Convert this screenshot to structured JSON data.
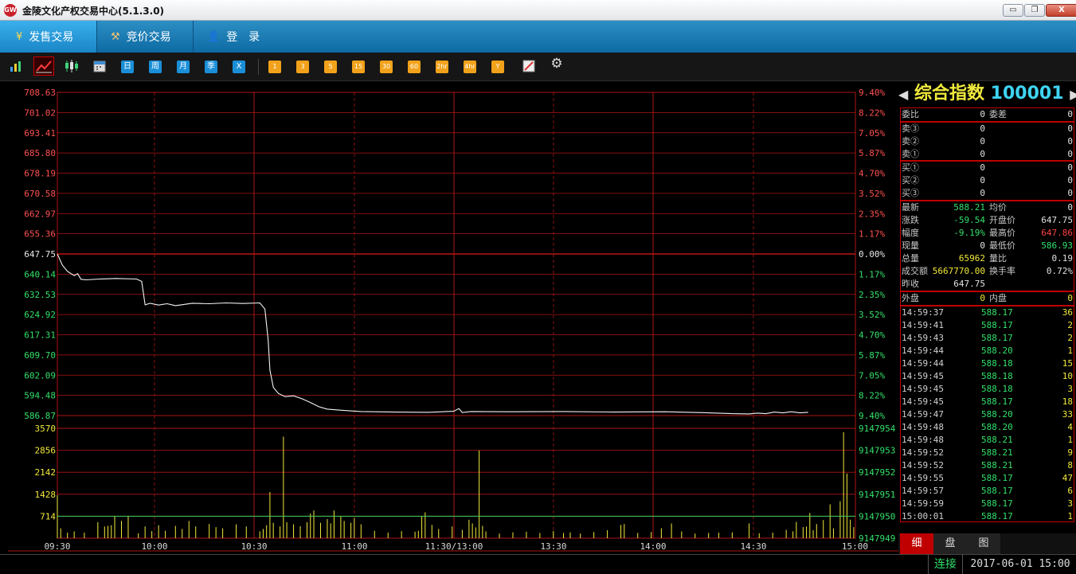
{
  "window": {
    "title": "金陵文化产权交易中心(5.1.3.0)",
    "logo": "GW",
    "min": "▭",
    "max": "❐",
    "close": "X"
  },
  "nav": {
    "tabs": [
      {
        "icon": "¥",
        "label": "发售交易"
      },
      {
        "icon": "⚒",
        "label": "竞价交易"
      },
      {
        "icon": "👤",
        "label": "登　录"
      }
    ]
  },
  "toolbar": {
    "period_day": "日",
    "period_week": "周",
    "period_month": "月",
    "period_season": "季",
    "period_x": "X",
    "min_1": "1",
    "min_3": "3",
    "min_5": "5",
    "min_15": "15",
    "min_30": "30",
    "min_60": "60",
    "hr_2": "2hr",
    "hr_4": "4hr",
    "year": "Y"
  },
  "panel": {
    "name": "综合指数",
    "code": "100001",
    "arrow_left": "◀",
    "arrow_right": "▶",
    "weibi": {
      "l": "委比",
      "v": "0",
      "l2": "委差",
      "v2": "0"
    },
    "sells": [
      {
        "l": "卖③",
        "v": "0",
        "v2": "0"
      },
      {
        "l": "卖②",
        "v": "0",
        "v2": "0"
      },
      {
        "l": "卖①",
        "v": "0",
        "v2": "0"
      }
    ],
    "buys": [
      {
        "l": "买①",
        "v": "0",
        "v2": "0"
      },
      {
        "l": "买②",
        "v": "0",
        "v2": "0"
      },
      {
        "l": "买③",
        "v": "0",
        "v2": "0"
      }
    ],
    "stats": [
      {
        "l": "最新",
        "v": "588.21",
        "vc": "#33e06a",
        "l2": "均价",
        "v2": "0",
        "v2c": "#e0e0e0"
      },
      {
        "l": "涨跌",
        "v": "-59.54",
        "vc": "#33e06a",
        "l2": "开盘价",
        "v2": "647.75",
        "v2c": "#e0e0e0"
      },
      {
        "l": "幅度",
        "v": "-9.19%",
        "vc": "#33e06a",
        "l2": "最高价",
        "v2": "647.86",
        "v2c": "#ff4040"
      },
      {
        "l": "现量",
        "v": "0",
        "vc": "#e0e0e0",
        "l2": "最低价",
        "v2": "586.93",
        "v2c": "#33e06a"
      },
      {
        "l": "总量",
        "v": "65962",
        "vc": "#f2e93a",
        "l2": "量比",
        "v2": "0.19",
        "v2c": "#e0e0e0"
      },
      {
        "l": "成交额",
        "v": "5667770.00",
        "vc": "#f2e93a",
        "l2": "换手率",
        "v2": "0.72%",
        "v2c": "#e0e0e0"
      },
      {
        "l": "昨收",
        "v": "647.75",
        "vc": "#e0e0e0",
        "l2": "",
        "v2": "",
        "v2c": "#e0e0e0"
      }
    ],
    "outer": {
      "l": "外盘",
      "v": "0",
      "l2": "内盘",
      "v2": "0"
    },
    "ticks": [
      {
        "t": "14:59:37",
        "p": "588.17",
        "v": "36"
      },
      {
        "t": "14:59:41",
        "p": "588.17",
        "v": "2"
      },
      {
        "t": "14:59:43",
        "p": "588.17",
        "v": "2"
      },
      {
        "t": "14:59:44",
        "p": "588.20",
        "v": "1"
      },
      {
        "t": "14:59:44",
        "p": "588.18",
        "v": "15"
      },
      {
        "t": "14:59:45",
        "p": "588.18",
        "v": "10"
      },
      {
        "t": "14:59:45",
        "p": "588.18",
        "v": "3"
      },
      {
        "t": "14:59:45",
        "p": "588.17",
        "v": "18"
      },
      {
        "t": "14:59:47",
        "p": "588.20",
        "v": "33"
      },
      {
        "t": "14:59:48",
        "p": "588.20",
        "v": "4"
      },
      {
        "t": "14:59:48",
        "p": "588.21",
        "v": "1"
      },
      {
        "t": "14:59:52",
        "p": "588.21",
        "v": "9"
      },
      {
        "t": "14:59:52",
        "p": "588.21",
        "v": "8"
      },
      {
        "t": "14:59:55",
        "p": "588.17",
        "v": "47"
      },
      {
        "t": "14:59:57",
        "p": "588.17",
        "v": "6"
      },
      {
        "t": "14:59:59",
        "p": "588.17",
        "v": "3"
      },
      {
        "t": "15:00:01",
        "p": "588.17",
        "v": "1"
      }
    ],
    "tabs": [
      "细",
      "盘",
      "图"
    ]
  },
  "status": {
    "connection": "连接",
    "datetime": "2017-06-01 15:00"
  },
  "chart_data": {
    "type": "line",
    "price_ticks_left": [
      "708.63",
      "701.02",
      "693.41",
      "685.80",
      "678.19",
      "670.58",
      "662.97",
      "655.36",
      "647.75",
      "640.14",
      "632.53",
      "624.92",
      "617.31",
      "609.70",
      "602.09",
      "594.48",
      "586.87"
    ],
    "pct_ticks_right": [
      "9.40%",
      "8.22%",
      "7.05%",
      "5.87%",
      "4.70%",
      "3.52%",
      "2.35%",
      "1.17%",
      "0.00%",
      "1.17%",
      "2.35%",
      "3.52%",
      "4.70%",
      "5.87%",
      "7.05%",
      "8.22%",
      "9.40%"
    ],
    "vol_ticks_left": [
      "3570",
      "2856",
      "2142",
      "1428",
      "714"
    ],
    "vol_ticks_right": [
      "9147954",
      "9147953",
      "9147952",
      "9147951",
      "9147950",
      "9147949"
    ],
    "x_ticks": [
      "09:30",
      "10:00",
      "10:30",
      "11:00",
      "11:30/13:00",
      "13:30",
      "14:00",
      "14:30",
      "15:00"
    ],
    "price_range": [
      586.87,
      708.63
    ],
    "prev_close": 647.75,
    "volume_range": [
      0,
      3570
    ],
    "volume_avg_level": 714,
    "price_series": [
      [
        0,
        647.75
      ],
      [
        3,
        643.5
      ],
      [
        6,
        641.2
      ],
      [
        10,
        639.6
      ],
      [
        12,
        640.3
      ],
      [
        14,
        638.2
      ],
      [
        17,
        638.0
      ],
      [
        25,
        638.3
      ],
      [
        35,
        638.5
      ],
      [
        47,
        638.3
      ],
      [
        50,
        637.4
      ],
      [
        52,
        628.6
      ],
      [
        55,
        629.2
      ],
      [
        60,
        628.5
      ],
      [
        65,
        629.0
      ],
      [
        70,
        628.3
      ],
      [
        80,
        629.2
      ],
      [
        90,
        629.0
      ],
      [
        100,
        629.3
      ],
      [
        110,
        629.1
      ],
      [
        120,
        629.3
      ],
      [
        123,
        627.0
      ],
      [
        125,
        615.0
      ],
      [
        126,
        604.0
      ],
      [
        128,
        597.5
      ],
      [
        131,
        595.2
      ],
      [
        135,
        594.0
      ],
      [
        140,
        594.3
      ],
      [
        145,
        593.2
      ],
      [
        150,
        591.8
      ],
      [
        155,
        590.2
      ],
      [
        160,
        589.3
      ],
      [
        170,
        588.8
      ],
      [
        180,
        588.4
      ],
      [
        200,
        588.2
      ],
      [
        220,
        588.1
      ],
      [
        235,
        588.5
      ],
      [
        238,
        589.5
      ],
      [
        240,
        588.0
      ],
      [
        245,
        588.4
      ],
      [
        270,
        588.3
      ],
      [
        300,
        588.4
      ],
      [
        330,
        588.2
      ],
      [
        360,
        588.3
      ],
      [
        380,
        588.0
      ],
      [
        395,
        587.7
      ],
      [
        400,
        587.6
      ],
      [
        410,
        587.5
      ],
      [
        415,
        587.8
      ],
      [
        420,
        587.6
      ],
      [
        425,
        588.2
      ],
      [
        430,
        587.9
      ],
      [
        435,
        588.3
      ],
      [
        440,
        587.9
      ],
      [
        445,
        588.1
      ]
    ],
    "volume_spikes": [
      [
        0,
        1400
      ],
      [
        1,
        240
      ],
      [
        2,
        320
      ],
      [
        3,
        300
      ],
      [
        6,
        180
      ],
      [
        10,
        220
      ],
      [
        16,
        180
      ],
      [
        24,
        520
      ],
      [
        25,
        900
      ],
      [
        28,
        380
      ],
      [
        30,
        400
      ],
      [
        32,
        420
      ],
      [
        34,
        720
      ],
      [
        38,
        560
      ],
      [
        42,
        720
      ],
      [
        48,
        160
      ],
      [
        52,
        380
      ],
      [
        56,
        230
      ],
      [
        60,
        420
      ],
      [
        64,
        240
      ],
      [
        70,
        400
      ],
      [
        74,
        300
      ],
      [
        78,
        560
      ],
      [
        82,
        380
      ],
      [
        90,
        460
      ],
      [
        94,
        360
      ],
      [
        98,
        320
      ],
      [
        106,
        450
      ],
      [
        112,
        380
      ],
      [
        120,
        220
      ],
      [
        122,
        300
      ],
      [
        124,
        420
      ],
      [
        126,
        1500
      ],
      [
        128,
        500
      ],
      [
        132,
        380
      ],
      [
        134,
        3300
      ],
      [
        136,
        520
      ],
      [
        140,
        450
      ],
      [
        144,
        390
      ],
      [
        148,
        520
      ],
      [
        150,
        800
      ],
      [
        152,
        900
      ],
      [
        156,
        500
      ],
      [
        160,
        620
      ],
      [
        162,
        480
      ],
      [
        164,
        900
      ],
      [
        168,
        720
      ],
      [
        170,
        560
      ],
      [
        174,
        500
      ],
      [
        176,
        650
      ],
      [
        180,
        450
      ],
      [
        188,
        240
      ],
      [
        196,
        180
      ],
      [
        204,
        230
      ],
      [
        212,
        210
      ],
      [
        214,
        240
      ],
      [
        216,
        700
      ],
      [
        218,
        840
      ],
      [
        222,
        430
      ],
      [
        226,
        300
      ],
      [
        234,
        380
      ],
      [
        240,
        270
      ],
      [
        244,
        600
      ],
      [
        246,
        480
      ],
      [
        248,
        350
      ],
      [
        250,
        2850
      ],
      [
        252,
        400
      ],
      [
        254,
        220
      ],
      [
        262,
        150
      ],
      [
        270,
        190
      ],
      [
        278,
        210
      ],
      [
        286,
        170
      ],
      [
        294,
        230
      ],
      [
        300,
        170
      ],
      [
        304,
        190
      ],
      [
        310,
        150
      ],
      [
        318,
        200
      ],
      [
        326,
        260
      ],
      [
        334,
        430
      ],
      [
        336,
        460
      ],
      [
        344,
        170
      ],
      [
        352,
        200
      ],
      [
        358,
        320
      ],
      [
        364,
        480
      ],
      [
        370,
        220
      ],
      [
        378,
        150
      ],
      [
        386,
        170
      ],
      [
        392,
        180
      ],
      [
        400,
        190
      ],
      [
        410,
        480
      ],
      [
        416,
        160
      ],
      [
        424,
        180
      ],
      [
        432,
        270
      ],
      [
        436,
        220
      ],
      [
        438,
        530
      ],
      [
        442,
        360
      ],
      [
        443,
        1180
      ],
      [
        444,
        380
      ],
      [
        446,
        820
      ],
      [
        448,
        260
      ],
      [
        450,
        460
      ],
      [
        454,
        590
      ],
      [
        458,
        1100
      ],
      [
        461,
        320
      ],
      [
        464,
        1200
      ],
      [
        466,
        3440
      ],
      [
        468,
        2100
      ],
      [
        470,
        600
      ],
      [
        473,
        360
      ]
    ],
    "volume_total_points": 474
  }
}
